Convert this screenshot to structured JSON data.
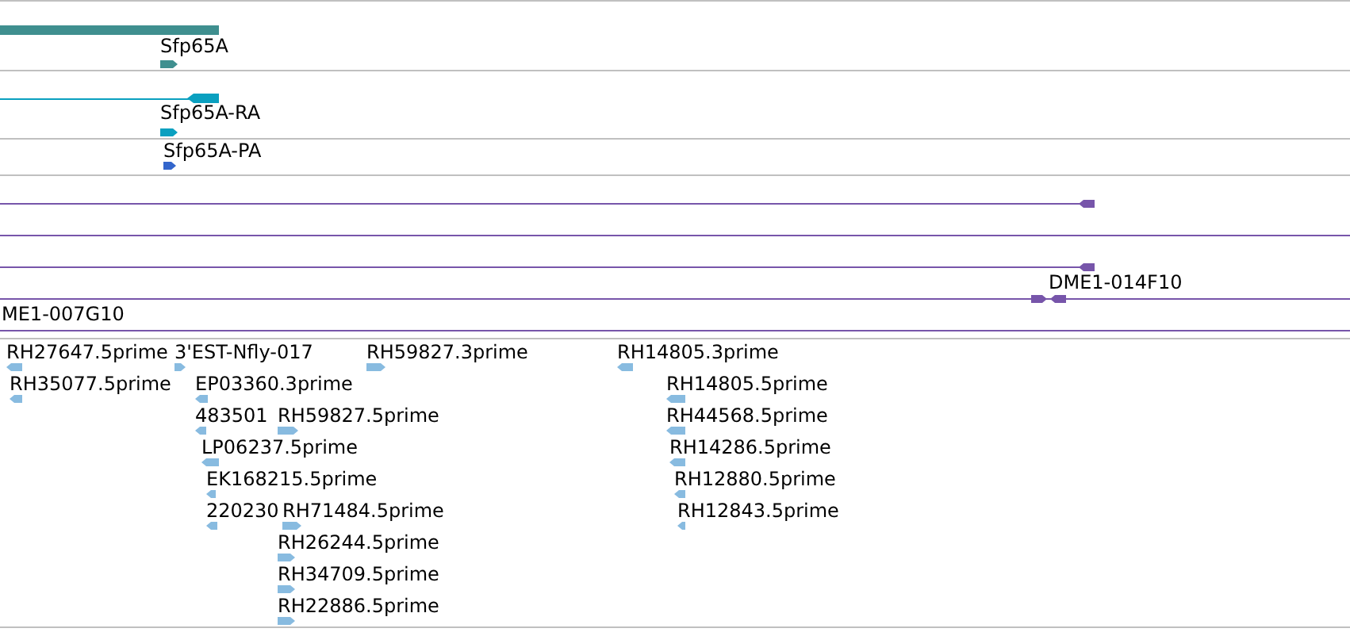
{
  "tracks": [
    {
      "kind": "gene",
      "features": [
        {
          "label": "Sfp65A",
          "reverse": false
        }
      ]
    },
    {
      "kind": "transcript",
      "features": [
        {
          "label": "Sfp65A-RA",
          "reverse": false
        }
      ]
    },
    {
      "kind": "protein",
      "features": [
        {
          "label": "Sfp65A-PA",
          "reverse": false
        }
      ]
    },
    {
      "kind": "clone",
      "features": [
        {
          "label": "DME1-014F10"
        },
        {
          "label": "ME1-007G10"
        }
      ]
    },
    {
      "kind": "est",
      "features": [
        {
          "label": "RH27647.5prime",
          "reverse": true
        },
        {
          "label": "3'EST-Nfly-017",
          "reverse": false
        },
        {
          "label": "RH59827.3prime",
          "reverse": false
        },
        {
          "label": "RH14805.3prime",
          "reverse": true
        },
        {
          "label": "RH35077.5prime",
          "reverse": true
        },
        {
          "label": "EP03360.3prime",
          "reverse": true
        },
        {
          "label": "RH14805.5prime",
          "reverse": true
        },
        {
          "label": "483501",
          "reverse": true
        },
        {
          "label": "RH59827.5prime",
          "reverse": false
        },
        {
          "label": "RH44568.5prime",
          "reverse": true
        },
        {
          "label": "LP06237.5prime",
          "reverse": true
        },
        {
          "label": "RH14286.5prime",
          "reverse": true
        },
        {
          "label": "EK168215.5prime",
          "reverse": true
        },
        {
          "label": "RH12880.5prime",
          "reverse": true
        },
        {
          "label": "220230",
          "reverse": true
        },
        {
          "label": "RH71484.5prime",
          "reverse": false
        },
        {
          "label": "RH12843.5prime",
          "reverse": true
        },
        {
          "label": "RH26244.5prime",
          "reverse": false
        },
        {
          "label": "RH34709.5prime",
          "reverse": false
        },
        {
          "label": "RH22886.5prime",
          "reverse": false
        }
      ]
    }
  ]
}
